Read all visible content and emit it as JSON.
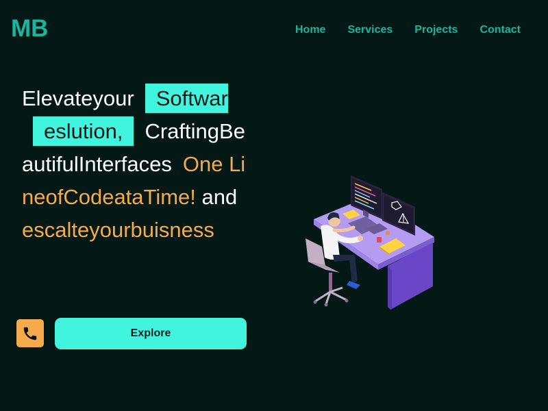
{
  "header": {
    "logo": "MB",
    "nav": [
      "Home",
      "Services",
      "Projects",
      "Contact"
    ]
  },
  "hero": {
    "part1": "Elevateyour",
    "highlight1": "Softwar",
    "highlight2": "eslution,",
    "part2": "CraftingBeautifulInterfaces",
    "orange1": "One LineofCodeataTime!",
    "part3": "and",
    "orange2": "escalteyourbuisness"
  },
  "actions": {
    "explore_label": "Explore"
  },
  "icons": {
    "phone": "phone-icon",
    "illustration": "developer-at-desk-illustration"
  },
  "colors": {
    "background": "#041816",
    "accent_teal": "#41f4de",
    "nav_teal": "#1bb59c",
    "accent_orange": "#f5ab4b"
  }
}
